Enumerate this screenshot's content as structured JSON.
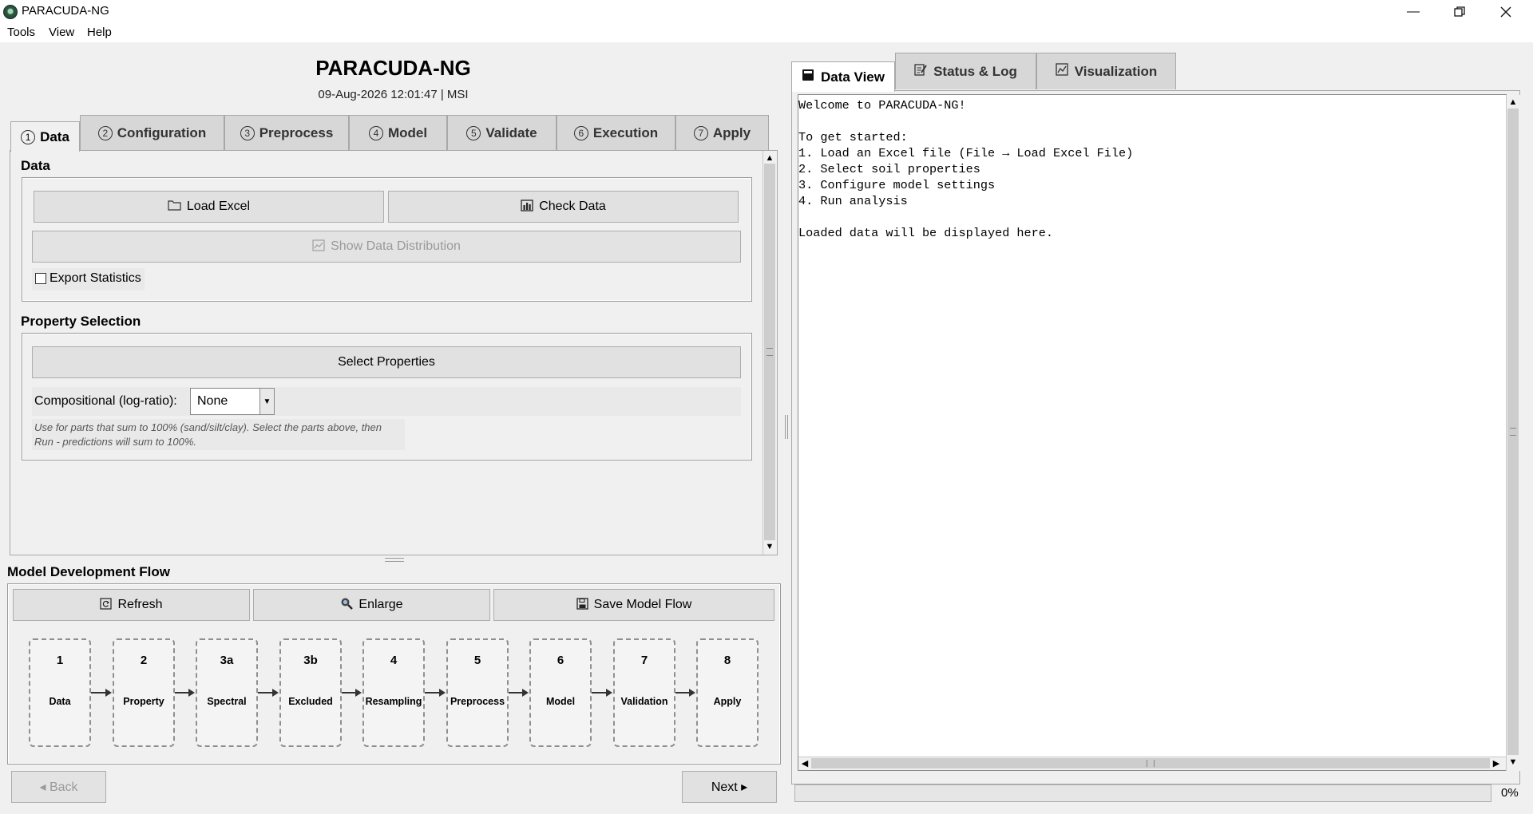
{
  "window": {
    "title": "PARACUDA-NG",
    "controls": [
      "minimize-icon",
      "maximize-icon",
      "close-icon"
    ]
  },
  "menu": [
    "Tools",
    "View",
    "Help"
  ],
  "header": {
    "title": "PARACUDA-NG",
    "subtitle": "09-Aug-2026 12:01:47 | MSI"
  },
  "left_tabs": [
    {
      "num": "1",
      "label": "Data"
    },
    {
      "num": "2",
      "label": "Configuration"
    },
    {
      "num": "3",
      "label": "Preprocess"
    },
    {
      "num": "4",
      "label": "Model"
    },
    {
      "num": "5",
      "label": "Validate"
    },
    {
      "num": "6",
      "label": "Execution"
    },
    {
      "num": "7",
      "label": "Apply"
    }
  ],
  "active_left_tab": "Data",
  "data_section": {
    "label": "Data",
    "load_excel": "Load Excel",
    "check_data": "Check Data",
    "show_distribution": "Show Data Distribution",
    "export_statistics": "Export Statistics",
    "export_checked": false
  },
  "property_section": {
    "label": "Property Selection",
    "select_properties": "Select Properties",
    "compositional_label": "Compositional (log-ratio):",
    "compositional_value": "None",
    "hint_line1": "Use for parts that sum to 100% (sand/silt/clay). Select the parts above, then",
    "hint_line2": "Run - predictions will sum to 100%."
  },
  "flow": {
    "label": "Model Development Flow",
    "refresh": "Refresh",
    "enlarge": "Enlarge",
    "save": "Save Model Flow",
    "steps": [
      {
        "num": "1",
        "name": "Data"
      },
      {
        "num": "2",
        "name": "Property"
      },
      {
        "num": "3a",
        "name": "Spectral"
      },
      {
        "num": "3b",
        "name": "Excluded"
      },
      {
        "num": "4",
        "name": "Resampling"
      },
      {
        "num": "5",
        "name": "Preprocess"
      },
      {
        "num": "6",
        "name": "Model"
      },
      {
        "num": "7",
        "name": "Validation"
      },
      {
        "num": "8",
        "name": "Apply"
      }
    ]
  },
  "nav": {
    "back": "◂ Back",
    "next": "Next ▸"
  },
  "right_tabs": [
    {
      "label": "Data View",
      "icon": "data-view-icon"
    },
    {
      "label": "Status & Log",
      "icon": "log-icon"
    },
    {
      "label": "Visualization",
      "icon": "chart-icon"
    }
  ],
  "active_right_tab": "Data View",
  "data_view_text": "Welcome to PARACUDA-NG!\n\nTo get started:\n1. Load an Excel file (File → Load Excel File)\n2. Select soil properties\n3. Configure model settings\n4. Run analysis\n\nLoaded data will be displayed here.",
  "progress": {
    "value": 0,
    "label": "0%"
  },
  "colors": {
    "background": "#f0f0f0",
    "tab_inactive": "#d7d7d7",
    "button": "#e1e1e1",
    "progress_fill": "#06b025"
  }
}
